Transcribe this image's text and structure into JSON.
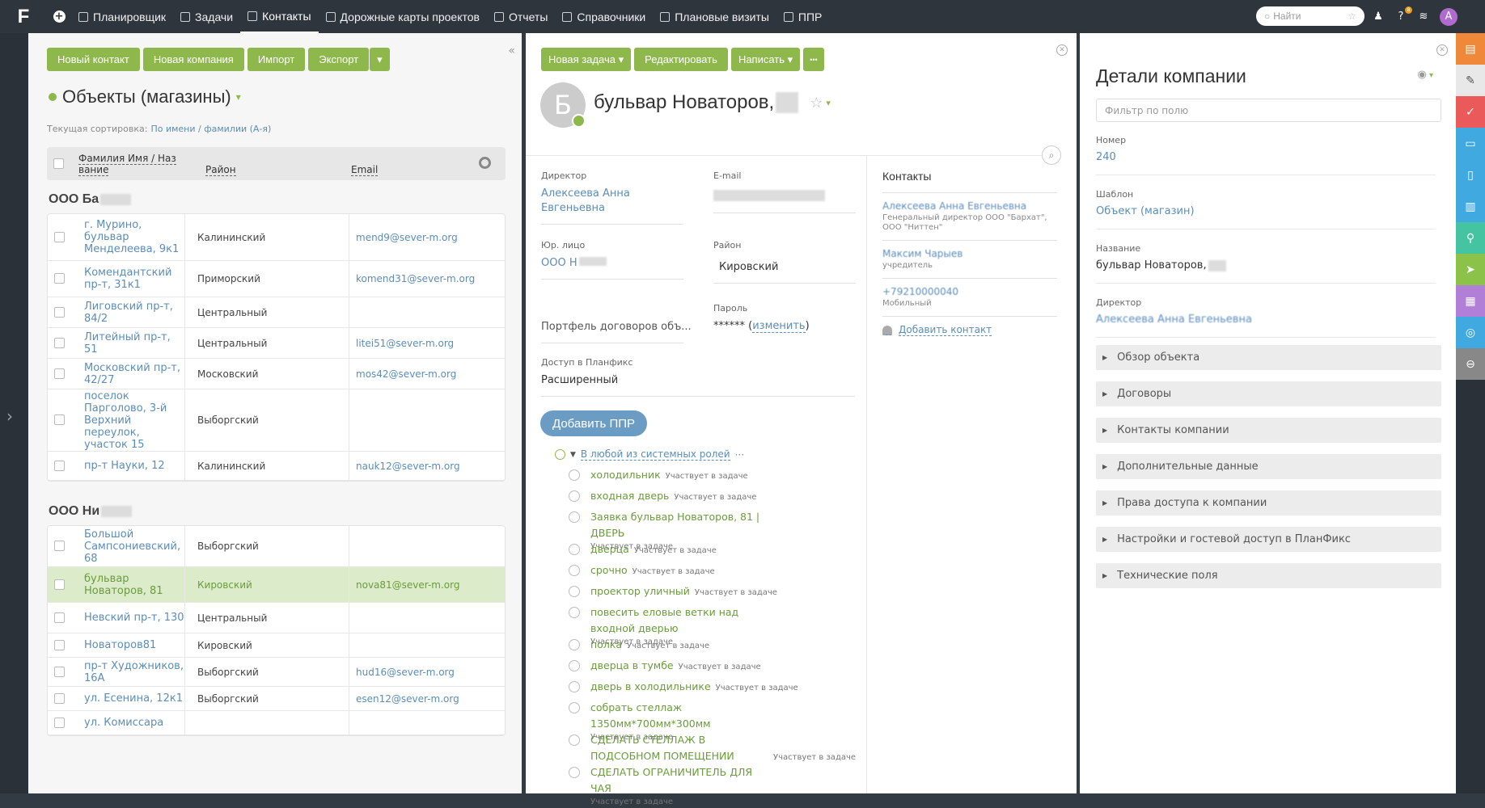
{
  "topbar": {
    "logo": "F",
    "nav": [
      {
        "label": "Планировщик",
        "active": false
      },
      {
        "label": "Задачи",
        "active": false
      },
      {
        "label": "Контакты",
        "active": true
      },
      {
        "label": "Дорожные карты проектов",
        "active": false
      },
      {
        "label": "Отчеты",
        "active": false
      },
      {
        "label": "Справочники",
        "active": false
      },
      {
        "label": "Плановые визиты",
        "active": false
      },
      {
        "label": "ППР",
        "active": false
      }
    ],
    "search_placeholder": "Найти",
    "avatar_letter": "A",
    "help_badge": "8"
  },
  "left": {
    "buttons": {
      "new_contact": "Новый контакт",
      "new_company": "Новая компания",
      "import": "Импорт",
      "export": "Экспорт",
      "export_menu": "▾"
    },
    "collapse": "«",
    "title": "Объекты (магазины)",
    "sort_label": "Текущая сортировка:",
    "sort_value": "По имени / фамилии (А-я)",
    "headers": {
      "name1": "Фамилия Имя / Наз",
      "name2": "вание",
      "district": "Район",
      "email": "Email"
    },
    "groups": [
      {
        "name": "ООО Ба",
        "rows": [
          {
            "name": "г. Мурино, бульвар Менделеева, 9к1",
            "district": "Калининский",
            "email": "mend9@sever-m.org"
          },
          {
            "name": "Комендантский пр-т, 31к1",
            "district": "Приморский",
            "email": "komend31@sever-m.org"
          },
          {
            "name": "Лиговский пр-т, 84/2",
            "district": "Центральный",
            "email": ""
          },
          {
            "name": "Литейный пр-т, 51",
            "district": "Центральный",
            "email": "litei51@sever-m.org"
          },
          {
            "name": "Московский пр-т, 42/27",
            "district": "Московский",
            "email": "mos42@sever-m.org"
          },
          {
            "name": "поселок Парголово, 3-й Верхний переулок, участок 15",
            "district": "Выборгский",
            "email": ""
          },
          {
            "name": "пр-т Науки, 12",
            "district": "Калининский",
            "email": "nauk12@sever-m.org"
          }
        ]
      },
      {
        "name": "ООО Ни",
        "rows": [
          {
            "name": "Большой Сампсониевский, 68",
            "district": "Выборгский",
            "email": ""
          },
          {
            "name": "бульвар Новаторов, 81",
            "district": "Кировский",
            "email": "nova81@sever-m.org",
            "selected": true
          },
          {
            "name": "Невский пр-т, 130",
            "district": "Центральный",
            "email": ""
          },
          {
            "name": "Новаторов81",
            "district": "Кировский",
            "email": ""
          },
          {
            "name": "пр-т Художников, 16А",
            "district": "Выборгский",
            "email": "hud16@sever-m.org"
          },
          {
            "name": "ул. Есенина, 12к1",
            "district": "Выборгский",
            "email": "esen12@sever-m.org"
          },
          {
            "name": "ул. Комиссара",
            "district": "",
            "email": ""
          }
        ]
      }
    ]
  },
  "middle": {
    "buttons": {
      "new_task": "Новая задача ▾",
      "edit": "Редактировать",
      "write": "Написать ▾",
      "more": "•••"
    },
    "avatar_letter": "Б",
    "title": "бульвар Новаторов,",
    "fields": {
      "director_label": "Директор",
      "director_value": "Алексеева Анна Евгеньевна",
      "email_label": "E-mail",
      "legal_label": "Юр. лицо",
      "legal_value": "ООО Н",
      "district_label": "Район",
      "district_value": "Кировский",
      "portfolio_value": "Портфель договоров объ...",
      "password_label": "Пароль",
      "password_value": "******",
      "change_label": "изменить",
      "access_label": "Доступ в Планфикс",
      "access_value": "Расширенный"
    },
    "ppr_button": "Добавить ППР",
    "role_header": "В любой из системных ролей",
    "participant": "Участвует в задаче",
    "tasks": [
      {
        "title": "холодильник",
        "wrap": false
      },
      {
        "title": "входная дверь",
        "wrap": false
      },
      {
        "title": "Заявка бульвар Новаторов, 81 | ДВЕРЬ",
        "wrap": true
      },
      {
        "title": "дверца",
        "wrap": false
      },
      {
        "title": "срочно",
        "wrap": false
      },
      {
        "title": "проектор уличный",
        "wrap": false
      },
      {
        "title": "повесить еловые ветки над входной дверью",
        "wrap": true
      },
      {
        "title": "полка",
        "wrap": false
      },
      {
        "title": "дверца в тумбе",
        "wrap": false
      },
      {
        "title": "дверь в холодильнике",
        "wrap": false
      },
      {
        "title": "собрать стеллаж 1350мм*700мм*300мм",
        "wrap": true
      },
      {
        "title": "СДЕЛАТЬ СТЕЛЛАЖ В ПОДСОБНОМ ПОМЕЩЕНИИ",
        "wrap": false
      },
      {
        "title": "СДЕЛАТЬ ОГРАНИЧИТЕЛЬ ДЛЯ ЧАЯ",
        "wrap": true
      }
    ],
    "contacts": {
      "title": "Контакты",
      "items": [
        {
          "name": "Алексеева Анна Евгеньевна",
          "sub": "Генеральный директор ООО \"Бархат\", ООО \"Ниттен\""
        },
        {
          "name": "Максим Чарыев",
          "sub": "учредитель"
        },
        {
          "name": "+79210000040",
          "sub": "Мобильный"
        }
      ],
      "add": "Добавить контакт"
    }
  },
  "details": {
    "title": "Детали компании",
    "filter_placeholder": "Фильтр по полю",
    "fields": [
      {
        "label": "Номер",
        "value": "240",
        "link": true
      },
      {
        "label": "Шаблон",
        "value": "Объект (магазин)",
        "link": true
      },
      {
        "label": "Название",
        "value": "бульвар Новаторов,",
        "link": false
      },
      {
        "label": "Директор",
        "value": "Алексеева Анна Евгеньевна",
        "link": true
      }
    ],
    "sections": [
      "Обзор объекта",
      "Договоры",
      "Контакты компании",
      "Дополнительные данные",
      "Права доступа к компании",
      "Настройки и гостевой доступ в ПланФикс",
      "Технические поля"
    ]
  },
  "colors": {
    "green": "#8eb84b",
    "blue_link": "#5b8db8",
    "topbar": "#2f353d",
    "ppr": "#6b9cc4",
    "right_strip": [
      "#f0883a",
      "#e8e8e8",
      "#ea5a5a",
      "#3fa9e0",
      "#3fa9e0",
      "#3fa9e0",
      "#44c4a1",
      "#8bc34a",
      "#b27fd8",
      "#3fa9e0",
      "#888888"
    ]
  }
}
